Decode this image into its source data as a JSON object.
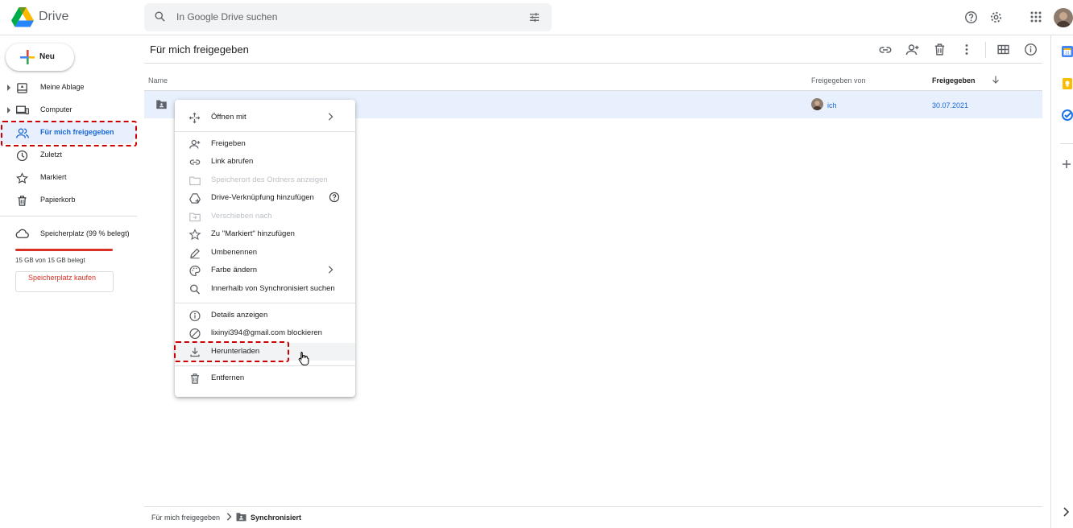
{
  "header": {
    "app_name": "Drive",
    "search_placeholder": "In Google Drive suchen"
  },
  "sidebar": {
    "new_label": "Neu",
    "items": [
      {
        "label": "Meine Ablage",
        "icon": "my-drive-icon",
        "expandable": true
      },
      {
        "label": "Computer",
        "icon": "computer-icon",
        "expandable": true
      },
      {
        "label": "Für mich freigegeben",
        "icon": "shared-with-me-icon",
        "active": true
      },
      {
        "label": "Zuletzt",
        "icon": "clock-icon"
      },
      {
        "label": "Markiert",
        "icon": "star-icon"
      },
      {
        "label": "Papierkorb",
        "icon": "trash-icon"
      }
    ],
    "storage_label": "Speicherplatz (99 % belegt)",
    "storage_used_text": "15 GB von 15 GB belegt",
    "storage_fraction": 0.99,
    "buy_storage_label": "Speicherplatz kaufen"
  },
  "main": {
    "title": "Für mich freigegeben",
    "columns": {
      "name": "Name",
      "shared_by": "Freigegeben von",
      "shared_date": "Freigegeben"
    },
    "rows": [
      {
        "name": "Synchronisiert",
        "shared_by": "ich",
        "shared_date": "30.07.2021"
      }
    ]
  },
  "context_menu": {
    "items": [
      {
        "label": "Öffnen mit",
        "icon": "open-with-icon",
        "submenu": true
      },
      {
        "label": "Freigeben",
        "icon": "person-add-icon"
      },
      {
        "label": "Link abrufen",
        "icon": "link-icon"
      },
      {
        "label": "Speicherort des Ordners anzeigen",
        "icon": "folder-icon",
        "disabled": true
      },
      {
        "label": "Drive-Verknüpfung hinzufügen",
        "icon": "add-shortcut-icon",
        "help": true
      },
      {
        "label": "Verschieben nach",
        "icon": "move-icon",
        "disabled": true
      },
      {
        "label": "Zu \"Markiert\" hinzufügen",
        "icon": "star-icon"
      },
      {
        "label": "Umbenennen",
        "icon": "pencil-icon"
      },
      {
        "label": "Farbe ändern",
        "icon": "palette-icon",
        "submenu": true
      },
      {
        "label": "Innerhalb von Synchronisiert suchen",
        "icon": "search-icon"
      },
      {
        "label": "Details anzeigen",
        "icon": "info-icon"
      },
      {
        "label": "lixinyi394@gmail.com blockieren",
        "icon": "block-icon"
      },
      {
        "label": "Herunterladen",
        "icon": "download-icon",
        "hover": true
      },
      {
        "label": "Entfernen",
        "icon": "trash-icon"
      }
    ]
  },
  "breadcrumb": {
    "parent": "Für mich freigegeben",
    "current": "Synchronisiert"
  },
  "colors": {
    "accent_blue": "#1967d2",
    "selected_row": "#e8f0fe",
    "storage_red": "#d93025",
    "highlight_red": "#cc0000"
  }
}
